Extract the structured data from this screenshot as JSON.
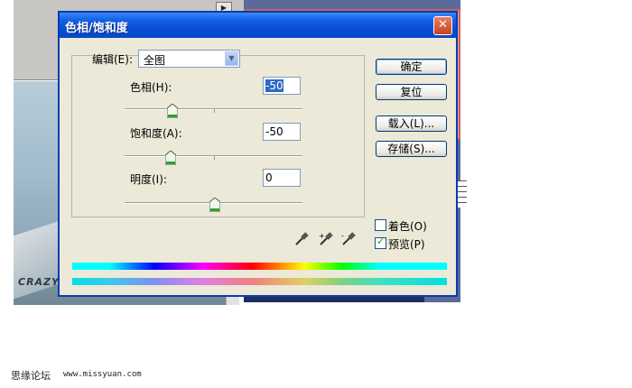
{
  "dialog": {
    "title": "色相/饱和度",
    "close_label": "✕",
    "edit_label": "编辑(E):",
    "edit_value": "全图",
    "hue_label": "色相(H):",
    "hue_value": "-50",
    "saturation_label": "饱和度(A):",
    "saturation_value": "-50",
    "lightness_label": "明度(I):",
    "lightness_value": "0",
    "buttons": {
      "ok": "确定",
      "reset": "复位",
      "load": "载入(L)...",
      "save": "存储(S)..."
    },
    "colorize_label": "着色(O)",
    "colorize_checked": false,
    "preview_label": "预览(P)",
    "preview_checked": true
  },
  "background": {
    "photo_text": "CRAZY"
  },
  "footer": {
    "site_name": "思缘论坛",
    "url": "www.missyuan.com"
  }
}
